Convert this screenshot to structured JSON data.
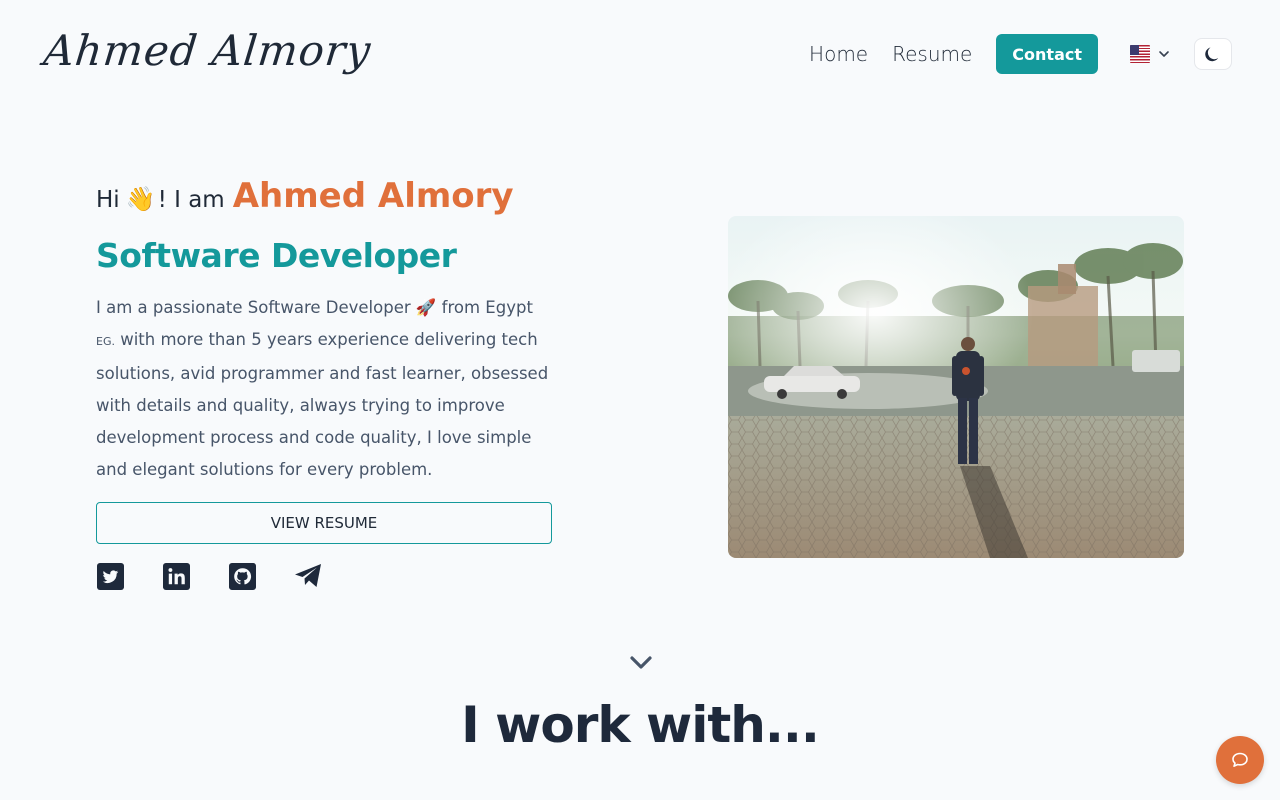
{
  "header": {
    "logo_text": "Ahmed Almory",
    "nav": [
      {
        "label": "Home"
      },
      {
        "label": "Resume"
      }
    ],
    "contact_label": "Contact",
    "language": "en-US",
    "theme_icon": "moon-icon"
  },
  "hero": {
    "greeting_hi": "Hi",
    "greeting_wave": "👋",
    "greeting_rest": "! I am",
    "name": "Ahmed Almory",
    "role": "Software Developer",
    "bio_part1": "I am a passionate Software Developer 🚀 from Egypt ",
    "bio_country_code": "EG.",
    "bio_part2": " with more than 5 years experience delivering tech solutions, avid programmer and fast learner, obsessed with details and quality, always trying to improve development process and code quality, I love simple and elegant solutions for every problem.",
    "resume_button": "VIEW RESUME",
    "socials": [
      "twitter-icon",
      "linkedin-icon",
      "github-icon",
      "telegram-icon"
    ]
  },
  "section": {
    "title": "I work with..."
  },
  "colors": {
    "accent_teal": "#14999b",
    "accent_orange": "#e0703b",
    "background": "#f8fafc"
  }
}
